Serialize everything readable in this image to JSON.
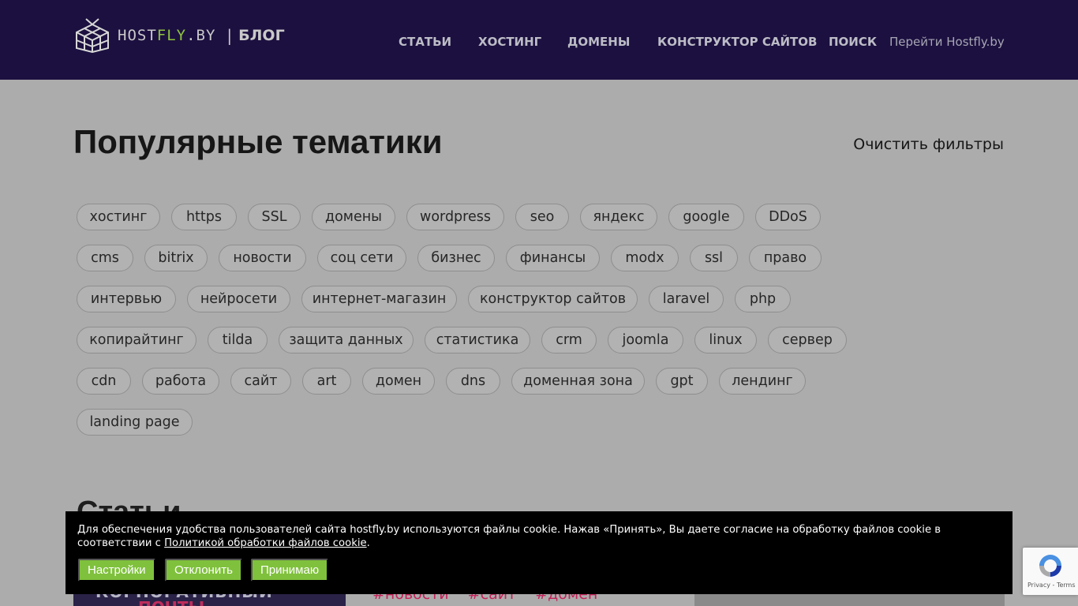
{
  "header": {
    "logo": {
      "prefix": "HOST",
      "highlight": "FLY",
      "suffix": ".BY",
      "separator": "|",
      "blog": "БЛОГ"
    },
    "nav": [
      {
        "label": "СТАТЬИ"
      },
      {
        "label": "ХОСТИНГ"
      },
      {
        "label": "ДОМЕНЫ"
      },
      {
        "label": "КОНСТРУКТОР САЙТОВ"
      },
      {
        "label": "ПОИСК"
      }
    ],
    "external_link": "Перейти Hostfly.by"
  },
  "topics": {
    "title": "Популярные тематики",
    "clear_filters": "Очистить фильтры",
    "tag_rows": [
      [
        "хостинг",
        "https",
        "SSL",
        "домены",
        "wordpress",
        "seo",
        "яндекс",
        "google",
        "DDoS"
      ],
      [
        "cms",
        "bitrix",
        "новости",
        "соц сети",
        "бизнес",
        "финансы",
        "modx",
        "ssl",
        "право"
      ],
      [
        "интервью",
        "нейросети",
        "интернет-магазин",
        "конструктор сайтов",
        "laravel",
        "php"
      ],
      [
        "копирайтинг",
        "tilda",
        "защита данных",
        "статистика",
        "crm",
        "joomla",
        "linux",
        "сервер"
      ],
      [
        "cdn",
        "работа",
        "сайт",
        "art",
        "домен",
        "dns",
        "доменная зона",
        "gpt",
        "лендинг"
      ],
      [
        "landing page"
      ]
    ]
  },
  "articles": {
    "title": "Статьи",
    "first_card": {
      "image_caption_1": "КОРПОРАТИВНЫЙ",
      "image_caption_2": "ПОЧТЫ",
      "tags": [
        "#новости",
        "#сайт",
        "#домен"
      ]
    }
  },
  "cookie_banner": {
    "text": "Для обеспечения удобства пользователей сайта hostfly.by используются файлы cookie. Нажав «Принять», Вы даете согласие на обработку файлов cookie в соответствии с ",
    "link": "Политикой обработки файлов cookie",
    "end": ".",
    "buttons": {
      "settings": "Настройки",
      "decline": "Отклонить",
      "accept": "Принимаю"
    }
  },
  "recaptcha": {
    "text": "Privacy - Terms"
  },
  "colors": {
    "header_bg": "#1c1040",
    "accent_green": "#7fc13c",
    "tag_link": "#c2235a",
    "overlay_bg": "#acacac"
  },
  "icons": {
    "logo": "cube-logo-icon",
    "recaptcha": "recaptcha-icon"
  }
}
